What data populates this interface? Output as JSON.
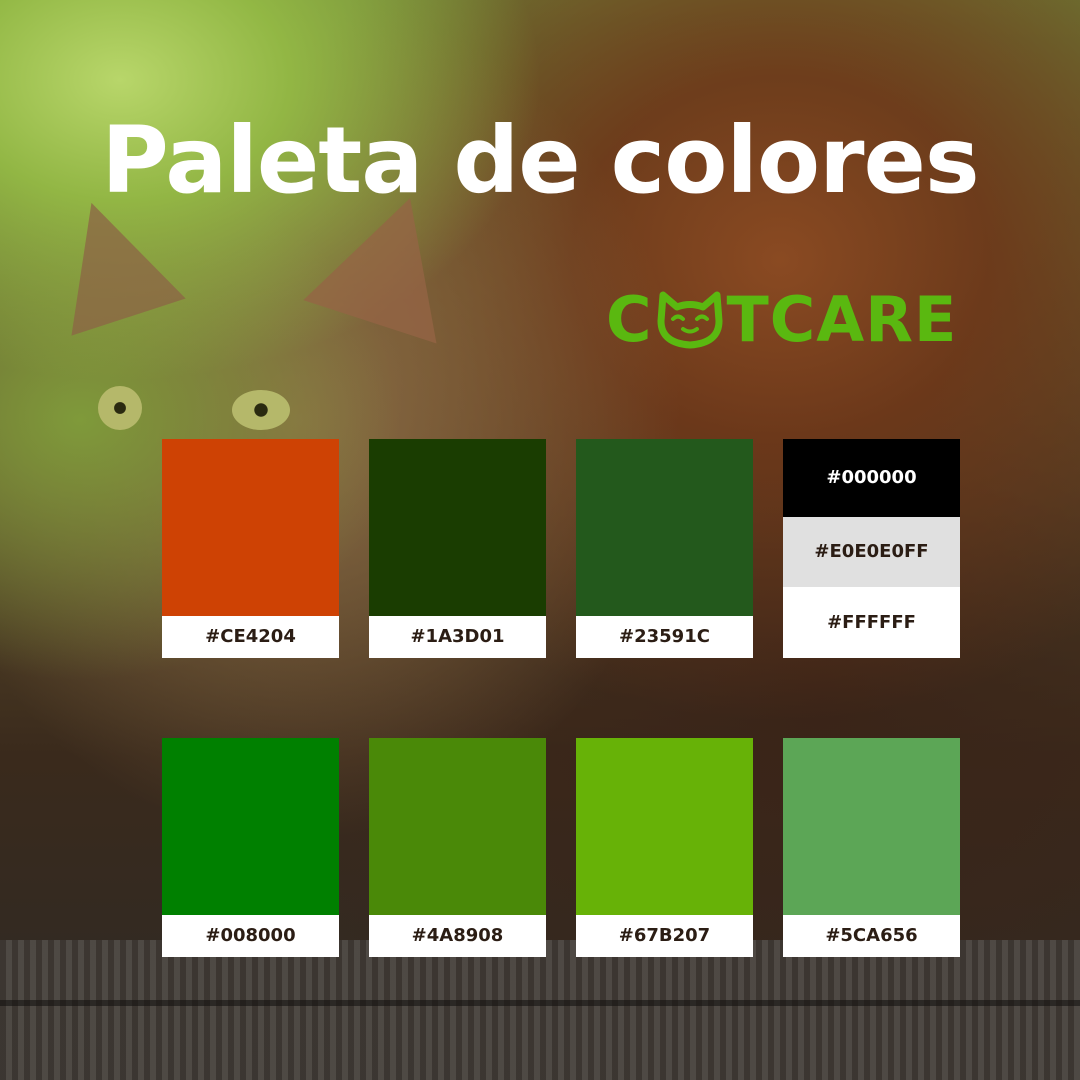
{
  "title": "Paleta de colores",
  "logo": {
    "prefix": "C",
    "suffix": "TCARE",
    "color": "#5ab810",
    "icon": "cat-face-icon"
  },
  "palette": {
    "row1": [
      {
        "hex": "#CE4204",
        "color": "#CE4204"
      },
      {
        "hex": "#1A3D01",
        "color": "#1A3D01"
      },
      {
        "hex": "#23591C",
        "color": "#23591C"
      }
    ],
    "stack": [
      {
        "hex": "#000000",
        "color": "#000000"
      },
      {
        "hex": "#E0E0E0FF",
        "color": "#E0E0E0"
      },
      {
        "hex": "#FFFFFF",
        "color": "#FFFFFF"
      }
    ],
    "row2": [
      {
        "hex": "#008000",
        "color": "#008000"
      },
      {
        "hex": "#4A8908",
        "color": "#4A8908"
      },
      {
        "hex": "#67B207",
        "color": "#67B207"
      },
      {
        "hex": "#5CA656",
        "color": "#5CA656"
      }
    ]
  }
}
